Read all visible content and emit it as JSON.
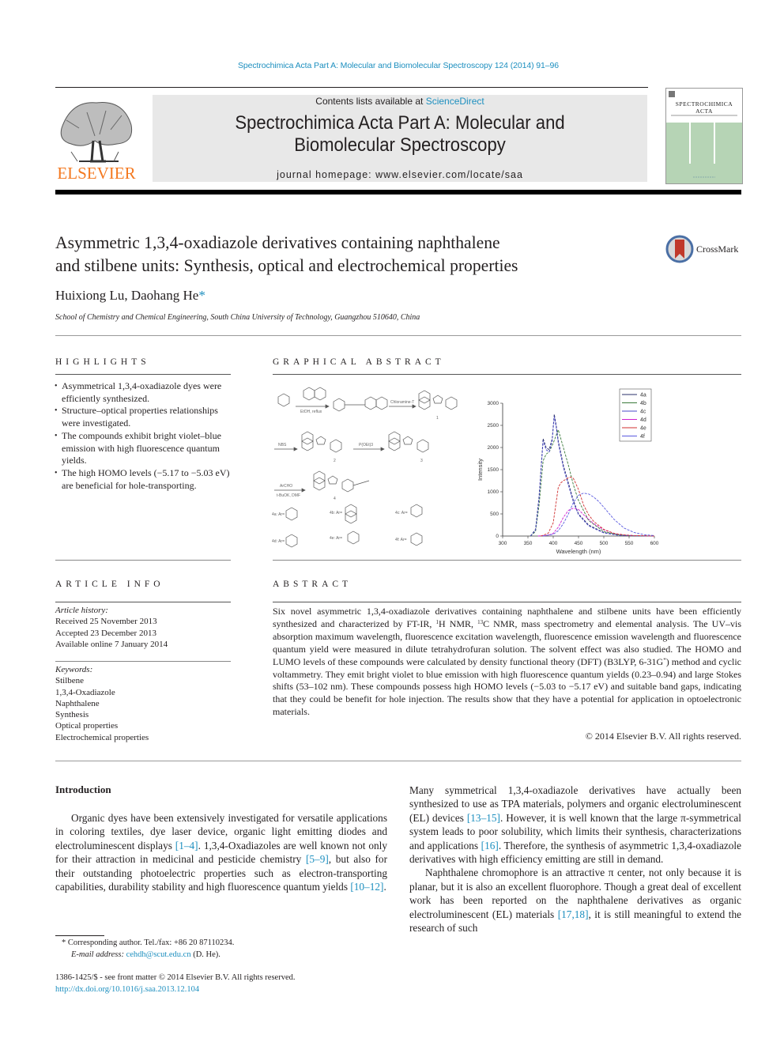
{
  "header": {
    "journal_reference": "Spectrochimica Acta Part A: Molecular and Biomolecular Spectroscopy 124 (2014) 91–96",
    "contents_prefix": "Contents lists available at ",
    "contents_link": "ScienceDirect",
    "journal_title_line1": "Spectrochimica Acta Part A: Molecular and",
    "journal_title_line2": "Biomolecular Spectroscopy",
    "homepage": "journal homepage: www.elsevier.com/locate/saa",
    "publisher_logo_text": "ELSEVIER",
    "cover_title_line1": "SPECTROCHIMICA",
    "cover_title_line2": "ACTA"
  },
  "article": {
    "title_line1": "Asymmetric 1,3,4-oxadiazole derivatives containing naphthalene",
    "title_line2": "and stilbene units: Synthesis, optical and electrochemical properties",
    "crossmark_label": "CrossMark",
    "authors": "Huixiong Lu, Daohang He",
    "author_mark": "*",
    "affiliation": "School of Chemistry and Chemical Engineering, South China University of Technology, Guangzhou 510640, China"
  },
  "highlights": {
    "heading": "HIGHLIGHTS",
    "items": [
      "Asymmetrical 1,3,4-oxadiazole dyes were efficiently synthesized.",
      "Structure–optical properties relationships were investigated.",
      "The compounds exhibit bright violet–blue emission with high fluorescence quantum yields.",
      "The high HOMO levels (−5.17 to −5.03 eV) are beneficial for hole-transporting."
    ]
  },
  "graphical_abstract": {
    "heading": "GRAPHICAL ABSTRACT",
    "scheme_labels": [
      "1",
      "2",
      "3",
      "4"
    ],
    "scheme_reagents": [
      "EtOH, reflux",
      "Chloramine-T",
      "NBS",
      "P(OEt)3",
      "ArCHO",
      "t-BuOK, DMF"
    ],
    "substituents": [
      "4a: Ar=",
      "4b: Ar=",
      "4c: Ar=",
      "4d: Ar=",
      "4e: Ar=",
      "4f: Ar="
    ]
  },
  "chart_data": {
    "type": "line",
    "title": "",
    "xlabel": "Wavelength (nm)",
    "ylabel": "Intensity",
    "xlim": [
      300,
      600
    ],
    "ylim": [
      0,
      3000
    ],
    "xticks": [
      300,
      350,
      400,
      450,
      500,
      550,
      600
    ],
    "yticks": [
      0,
      500,
      1000,
      1500,
      2000,
      2500,
      3000
    ],
    "legend_position": "top-right",
    "grid": false,
    "series": [
      {
        "name": "4a",
        "color": "#2a2f6a",
        "x": [
          355,
          365,
          372,
          380,
          386,
          392,
          398,
          402,
          406,
          410,
          420,
          430,
          440,
          450,
          470,
          500,
          530,
          560,
          600
        ],
        "y": [
          0,
          150,
          900,
          2200,
          2000,
          1950,
          2200,
          2750,
          2500,
          2150,
          1600,
          1200,
          800,
          500,
          250,
          80,
          20,
          5,
          0
        ]
      },
      {
        "name": "4b",
        "color": "#3a7a3a",
        "x": [
          355,
          365,
          372,
          380,
          386,
          392,
          400,
          405,
          410,
          420,
          430,
          440,
          450,
          470,
          500,
          530,
          560,
          600
        ],
        "y": [
          0,
          100,
          700,
          1700,
          1850,
          1900,
          2100,
          2250,
          2400,
          2000,
          1600,
          1150,
          800,
          350,
          100,
          25,
          5,
          0
        ]
      },
      {
        "name": "4c",
        "color": "#4a4ac8",
        "x": [
          355,
          365,
          372,
          380,
          386,
          392,
          398,
          402,
          406,
          410,
          420,
          430,
          440,
          450,
          470,
          500,
          530,
          560,
          600
        ],
        "y": [
          0,
          130,
          850,
          2150,
          1950,
          1900,
          2150,
          2700,
          2450,
          2100,
          1550,
          1150,
          760,
          480,
          230,
          70,
          15,
          5,
          0
        ]
      },
      {
        "name": "4d",
        "color": "#d020d0",
        "x": [
          370,
          390,
          400,
          410,
          420,
          430,
          440,
          450,
          460,
          470,
          480,
          500,
          520,
          540,
          560,
          600
        ],
        "y": [
          0,
          20,
          60,
          200,
          420,
          580,
          630,
          600,
          480,
          380,
          280,
          140,
          60,
          25,
          10,
          0
        ]
      },
      {
        "name": "4e",
        "color": "#d03030",
        "x": [
          375,
          390,
          400,
          405,
          410,
          415,
          420,
          425,
          430,
          435,
          440,
          450,
          460,
          470,
          480,
          500,
          520,
          540,
          560,
          600
        ],
        "y": [
          0,
          60,
          300,
          700,
          1100,
          1200,
          1250,
          1280,
          1320,
          1330,
          1300,
          1050,
          700,
          480,
          330,
          150,
          60,
          25,
          10,
          0
        ]
      },
      {
        "name": "4f",
        "color": "#5a5ae0",
        "x": [
          380,
          400,
          410,
          420,
          430,
          440,
          450,
          460,
          470,
          480,
          490,
          500,
          520,
          540,
          560,
          580,
          600
        ],
        "y": [
          0,
          40,
          120,
          280,
          500,
          760,
          920,
          970,
          950,
          880,
          780,
          650,
          380,
          180,
          80,
          30,
          10
        ]
      }
    ]
  },
  "article_info": {
    "heading": "ARTICLE INFO",
    "history_label": "Article history:",
    "history": [
      "Received 25 November 2013",
      "Accepted 23 December 2013",
      "Available online 7 January 2014"
    ],
    "keywords_label": "Keywords:",
    "keywords": [
      "Stilbene",
      "1,3,4-Oxadiazole",
      "Naphthalene",
      "Synthesis",
      "Optical properties",
      "Electrochemical properties"
    ]
  },
  "abstract": {
    "heading": "ABSTRACT",
    "part1": "Six novel asymmetric 1,3,4-oxadiazole derivatives containing naphthalene and stilbene units have been efficiently synthesized and characterized by FT-IR, ",
    "sup1": "1",
    "part2": "H NMR, ",
    "sup2": "13",
    "part3": "C NMR, mass spectrometry and elemental analysis. The UV–vis absorption maximum wavelength, fluorescence excitation wavelength, fluorescence emission wavelength and fluorescence quantum yield were measured in dilute tetrahydrofuran solution. The solvent effect was also studied. The HOMO and LUMO levels of these compounds were calculated by density functional theory (DFT) (B3LYP, 6-31G",
    "sup3": "*",
    "part4": ") method and cyclic voltammetry. They emit bright violet to blue emission with high fluorescence quantum yields (0.23–0.94) and large Stokes shifts (53–102 nm). These compounds possess high HOMO levels (−5.03 to −5.17 eV) and suitable band gaps, indicating that they could be benefit for hole injection. The results show that they have a potential for application in optoelectronic materials.",
    "copyright": "© 2014 Elsevier B.V. All rights reserved."
  },
  "introduction": {
    "heading": "Introduction",
    "p1_a": "Organic dyes have been extensively investigated for versatile applications in coloring textiles, dye laser device, organic light emitting diodes and electroluminescent displays ",
    "p1_ref1": "[1–4]",
    "p1_b": ". 1,3,4-Oxadiazoles are well known not only for their attraction in medicinal and pesticide chemistry ",
    "p1_ref2": "[5–9]",
    "p1_c": ", but also for their outstanding photoelectric properties such as electron-transporting capabilities, durability stability and high fluorescence quantum yields ",
    "p1_ref3": "[10–12]",
    "p1_d": ".",
    "p2_a": "Many symmetrical 1,3,4-oxadiazole derivatives have actually been synthesized to use as TPA materials, polymers and organic electroluminescent (EL) devices ",
    "p2_ref1": "[13–15]",
    "p2_b": ". However, it is well known that the large π-symmetrical system leads to poor solubility, which limits their synthesis, characterizations and applications ",
    "p2_ref2": "[16]",
    "p2_c": ". Therefore, the synthesis of asymmetric 1,3,4-oxadiazole derivatives with high efficiency emitting are still in demand.",
    "p3_a": "Naphthalene chromophore is an attractive π center, not only because it is planar, but it is also an excellent fluorophore. Though a great deal of excellent work has been reported on the naphthalene derivatives as organic electroluminescent (EL) materials ",
    "p3_ref1": "[17,18]",
    "p3_b": ", it is still meaningful to extend the research of such"
  },
  "footnotes": {
    "star": "*",
    "corresponding": "Corresponding author. Tel./fax: +86 20 87110234.",
    "email_label": "E-mail address:",
    "email": "cehdh@scut.edu.cn",
    "email_suffix": " (D. He).",
    "issn": "1386-1425/$ - see front matter © 2014 Elsevier B.V. All rights reserved.",
    "doi": "http://dx.doi.org/10.1016/j.saa.2013.12.104"
  },
  "colors": {
    "link": "#1d8fbf",
    "elsevier_orange": "#f47920",
    "cover_green": "#b6d4b5"
  }
}
